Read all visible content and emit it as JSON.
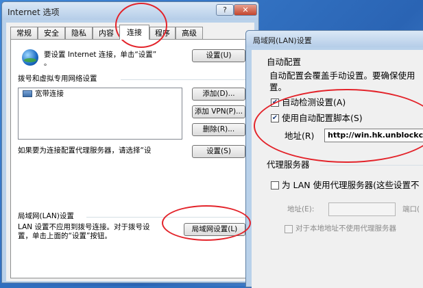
{
  "internet_options": {
    "title": "Internet 选项",
    "help_label": "?",
    "close_label": "✕",
    "tabs": [
      "常规",
      "安全",
      "隐私",
      "内容",
      "连接",
      "程序",
      "高级"
    ],
    "active_tab": "连接",
    "setup_text_1": "要设置 Internet 连接，单击“设置”",
    "setup_text_2": "。",
    "setup_button": "设置(U)",
    "dialup_section": "拨号和虚拟专用网络设置",
    "connections": [
      "宽带连接"
    ],
    "add_button": "添加(D)...",
    "add_vpn_button": "添加 VPN(P)...",
    "remove_button": "删除(R)...",
    "proxy_text_1": "如果要为连接配置代理服务器，请选择“设",
    "settings_button": "设置(S)",
    "lan_section": "局域网(LAN)设置",
    "lan_text_1": "LAN 设置不应用到拨号连接。对于拨号设",
    "lan_text_2": "置，单击上面的“设置”按钮。",
    "lan_button": "局域网设置(L)"
  },
  "lan_settings": {
    "title": "局域网(LAN)设置",
    "auto_config_heading": "自动配置",
    "auto_config_desc_1": "自动配置会覆盖手动设置。要确保使用",
    "auto_config_desc_2": "置。",
    "auto_detect_label": "自动检测设置(A)",
    "auto_detect_checked": true,
    "use_script_label": "使用自动配置脚本(S)",
    "use_script_checked": true,
    "address_label": "地址(R)",
    "address_value": "http://win.hk.unblockcn.",
    "proxy_heading": "代理服务器",
    "use_proxy_label": "为 LAN 使用代理服务器(这些设置不",
    "use_proxy_checked": false,
    "proxy_address_label": "地址(E):",
    "proxy_port_label": "端口(",
    "bypass_label": "对于本地地址不使用代理服务器",
    "bypass_checked": false,
    "check_mark": "✔"
  },
  "annotation_color": "#e3232a"
}
